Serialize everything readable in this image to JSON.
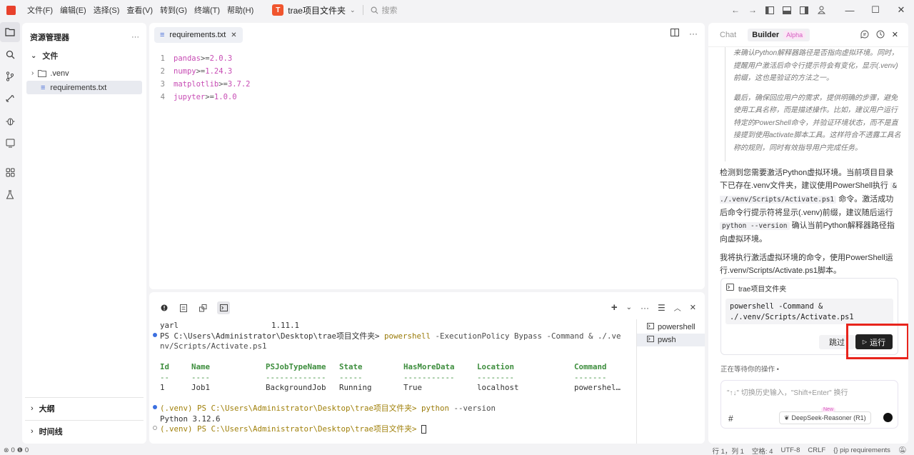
{
  "menu": [
    "文件(F)",
    "编辑(E)",
    "选择(S)",
    "查看(V)",
    "转到(G)",
    "终端(T)",
    "帮助(H)"
  ],
  "project": {
    "badge": "T",
    "name": "trae项目文件夹"
  },
  "search": {
    "placeholder": "搜索"
  },
  "explorer": {
    "title": "资源管理器",
    "section": "文件",
    "items": [
      ".venv",
      "requirements.txt"
    ],
    "outline": "大纲",
    "timeline": "时间线"
  },
  "editor": {
    "tab": "requirements.txt",
    "lines": [
      {
        "n": "1",
        "pkg": "pandas",
        "op": ">=",
        "ver": "2.0.3"
      },
      {
        "n": "2",
        "pkg": "numpy",
        "op": ">=",
        "ver": "1.24.3"
      },
      {
        "n": "3",
        "pkg": "matplotlib",
        "op": ">=",
        "ver": "3.7.2"
      },
      {
        "n": "4",
        "pkg": "jupyter",
        "op": ">=",
        "ver": "1.0.0"
      }
    ]
  },
  "terminal": {
    "l0": "yarl                    1.11.1",
    "l1a": "PS C:\\Users\\Administrator\\Desktop\\trae项目文件夹> ",
    "l1b": "powershell",
    "l1c": " -ExecutionPolicy Bypass -Command & ./.ve",
    "l2": "nv/Scripts/Activate.ps1",
    "headers": [
      "Id",
      "Name",
      "PSJobTypeName",
      "State",
      "HasMoreData",
      "Location",
      "Command"
    ],
    "dashes": [
      "--",
      "----",
      "-------------",
      "-----",
      "-----------",
      "--------",
      "-------"
    ],
    "row": [
      "1",
      "Job1",
      "BackgroundJob",
      "Running",
      "True",
      "localhost",
      "powershel…"
    ],
    "l6a": "(.venv) PS C:\\Users\\Administrator\\Desktop\\trae项目文件夹> ",
    "l6b": "python",
    "l6c": " --version",
    "l7": "Python 3.12.6",
    "l8": "(.venv) PS C:\\Users\\Administrator\\Desktop\\trae项目文件夹> ",
    "shells": [
      "powershell",
      "pwsh"
    ]
  },
  "ai": {
    "tab_chat": "Chat",
    "tab_builder": "Builder",
    "alpha": "Alpha",
    "thinking_1": "来确认Python解释器路径是否指向虚拟环境。同时，提醒用户激活后命令行提示符会有变化，显示(.venv)前缀，这也是验证的方法之一。",
    "thinking_2": "最后，确保回应用户的需求，提供明确的步骤，避免使用工具名称，而是描述操作。比如，建议用户运行特定的PowerShell命令，并验证环境状态，而不是直接提到使用activate脚本工具。这样符合不透露工具名称的规则，同时有效指导用户完成任务。",
    "msg_a": "检测到您需要激活Python虚拟环境。当前项目目录下已存在.venv文件夹，建议使用PowerShell执行",
    "msg_code1": "& ./.venv/Scripts/Activate.ps1",
    "msg_b": "命令。激活成功后命令行提示符将显示(.venv)前缀，建议随后运行",
    "msg_code2": "python --version",
    "msg_c": "确认当前Python解释器路径指向虚拟环境。",
    "msg2": "我将执行激活虚拟环境的命令，使用PowerShell运行.venv/Scripts/Activate.ps1脚本。",
    "card_title": "trae项目文件夹",
    "card_cmd": "powershell -Command &\n./.venv/Scripts/Activate.ps1",
    "skip": "跳过",
    "run": "运行",
    "waiting": "正在等待你的操作",
    "input_placeholder": "\"↑↓\" 切换历史输入，\"Shift+Enter\" 换行",
    "hash": "#",
    "model": "DeepSeek-Reasoner (R1)",
    "new": "New"
  },
  "status": {
    "errors": "0",
    "warnings": "0",
    "position": "行 1，列 1",
    "spaces": "空格: 4",
    "encoding": "UTF-8",
    "eol": "CRLF",
    "language": "{} pip requirements"
  }
}
